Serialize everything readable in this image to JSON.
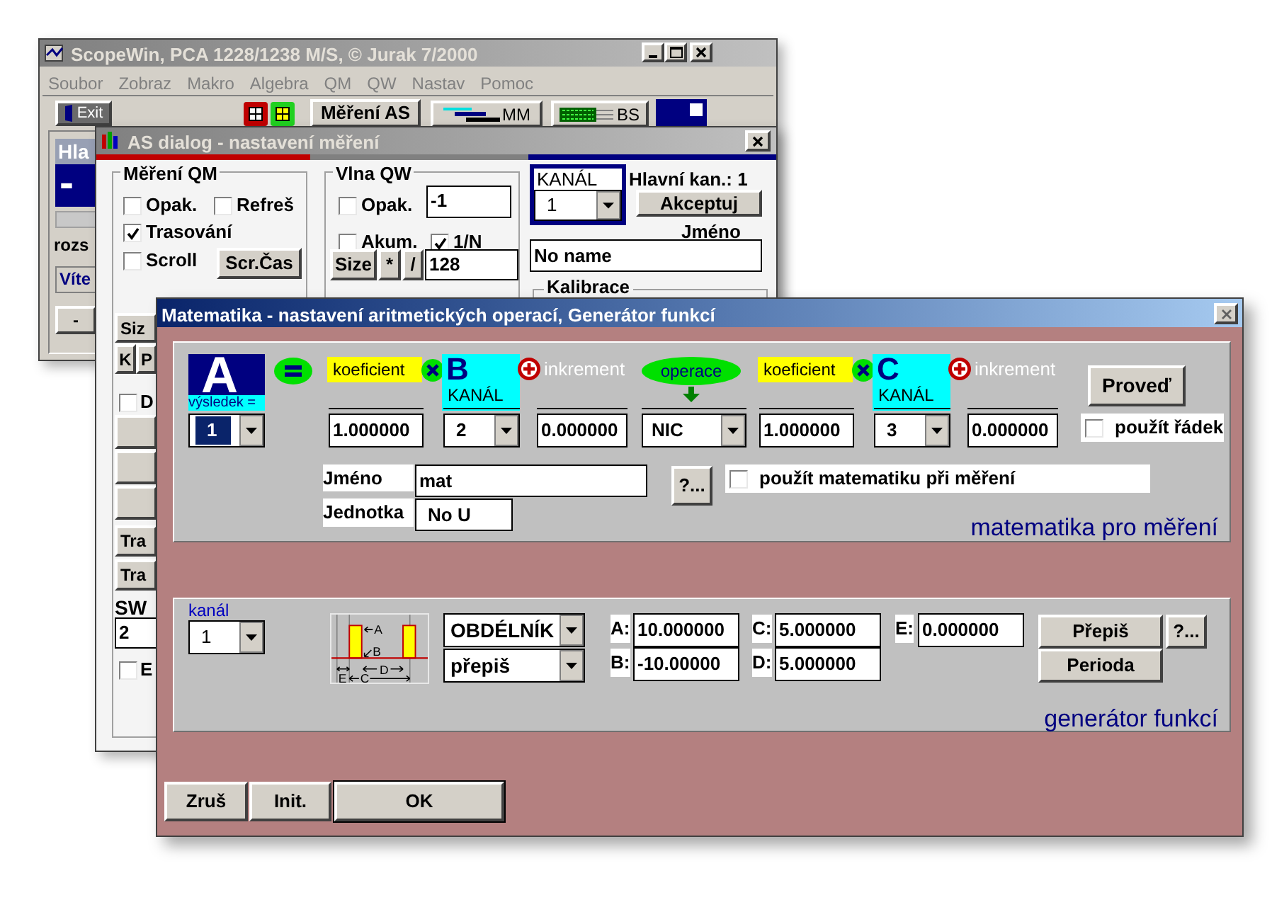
{
  "main_window": {
    "title": "ScopeWin, PCA 1228/1238 M/S,  © Jurak 7/2000",
    "menu": [
      "Soubor",
      "Zobraz",
      "Makro",
      "Algebra",
      "QM",
      "QW",
      "Nastav",
      "Pomoc"
    ],
    "toolbar": {
      "exit_button": "Exit",
      "measure_button": "Měření AS",
      "mm_button": "MM",
      "bs_button": "BS"
    },
    "side_panel": {
      "header": "Hla",
      "value": "-",
      "label": "rozs",
      "info": "Víte",
      "button": "-"
    }
  },
  "as_dialog": {
    "title": "AS dialog - nastavení měření",
    "qm_group": {
      "title": "Měření QM",
      "checkboxes": [
        {
          "label": "Opak.",
          "checked": false
        },
        {
          "label": "Refreš",
          "checked": false
        },
        {
          "label": "Trasování",
          "checked": true
        },
        {
          "label": "Scroll",
          "checked": false
        }
      ],
      "button": "Scr.Čas"
    },
    "left_strip": {
      "size_button": "Siz",
      "k_button": "K",
      "p_button": "P",
      "d_checkbox": {
        "label": "D",
        "checked": false
      },
      "tra_buttons": [
        "Tra",
        "Tra"
      ],
      "sw_label": "SW",
      "sw_field": "2",
      "e_checkbox": {
        "label": "E",
        "checked": false
      }
    },
    "qw_group": {
      "title": "Vlna QW",
      "checkboxes": [
        {
          "label": "Opak.",
          "checked": false
        },
        {
          "label": "Akum.",
          "checked": false
        },
        {
          "label": "1/N",
          "checked": true
        }
      ],
      "count_field": "-1",
      "buttons": [
        "Size",
        "*",
        "/"
      ],
      "size_field": "128"
    },
    "channel": {
      "label": "KANÁL",
      "value": "1"
    },
    "main_channel": "Hlavní kan.: 1",
    "accept_button": "Akceptuj",
    "name_label": "Jméno",
    "name_field": "No name",
    "calibration_group": "Kalibrace"
  },
  "math_dialog": {
    "title": "Matematika - nastavení aritmetických operací, Generátor funkcí",
    "math_panel": {
      "result": {
        "letter": "A",
        "caption": "výsledek =",
        "channel": "1"
      },
      "terms": [
        {
          "coefficient_label": "koeficient",
          "channel_letter": "B",
          "channel_label": "KANÁL",
          "increment_label": "inkrement",
          "coefficient": "1.000000",
          "channel": "2",
          "increment": "0.000000"
        },
        {
          "coefficient_label": "koeficient",
          "channel_letter": "C",
          "channel_label": "KANÁL",
          "increment_label": "inkrement",
          "coefficient": "1.000000",
          "channel": "3",
          "increment": "0.000000"
        }
      ],
      "operation": {
        "label": "operace",
        "value": "NIC"
      },
      "run_button": "Proveď",
      "use_row": {
        "label": "použít řádek",
        "checked": false
      },
      "name_label": "Jméno",
      "name_field": "mat",
      "unit_label": "Jednotka",
      "unit_field": "No U",
      "help_button": "?...",
      "use_math": {
        "label": "použít matematiku při měření",
        "checked": false
      },
      "caption": "matematika pro měření"
    },
    "generator_panel": {
      "channel_label": "kanál",
      "channel": "1",
      "diagram_labels": [
        "A",
        "B",
        "D",
        "E",
        "C"
      ],
      "waveform": "OBDÉLNÍK",
      "mode": "přepiš",
      "params": [
        {
          "name": "A:",
          "value": "10.000000"
        },
        {
          "name": "B:",
          "value": "-10.00000"
        },
        {
          "name": "C:",
          "value": "5.000000"
        },
        {
          "name": "D:",
          "value": "5.000000"
        },
        {
          "name": "E:",
          "value": "0.000000"
        }
      ],
      "write_button": "Přepiš",
      "help_button": "?...",
      "period_button": "Perioda",
      "caption": "generátor funkcí"
    },
    "buttons": [
      "Zruš",
      "Init.",
      "OK"
    ]
  }
}
